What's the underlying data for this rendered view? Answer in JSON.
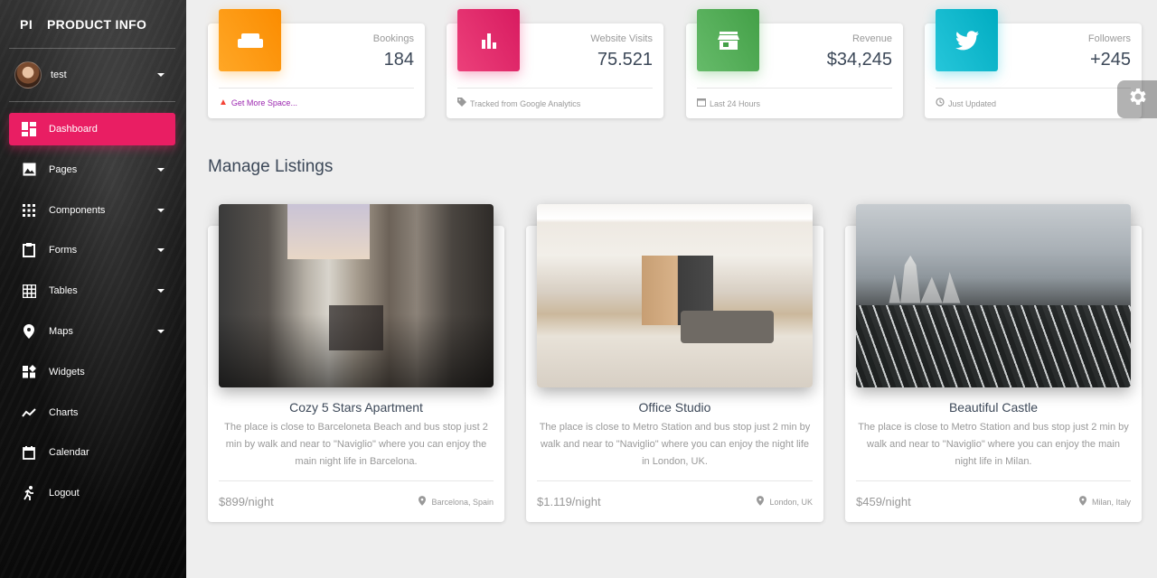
{
  "sidebar": {
    "logo_mini": "PI",
    "logo_full": "PRODUCT INFO",
    "user_name": "test",
    "items": [
      {
        "label": "Dashboard",
        "icon": "dashboard-icon",
        "active": true
      },
      {
        "label": "Pages",
        "icon": "image-icon",
        "has_caret": true
      },
      {
        "label": "Components",
        "icon": "apps-grid-icon",
        "has_caret": true
      },
      {
        "label": "Forms",
        "icon": "clipboard-icon",
        "has_caret": true
      },
      {
        "label": "Tables",
        "icon": "grid-icon",
        "has_caret": true
      },
      {
        "label": "Maps",
        "icon": "place-icon",
        "has_caret": true
      },
      {
        "label": "Widgets",
        "icon": "widgets-icon"
      },
      {
        "label": "Charts",
        "icon": "timeline-icon"
      },
      {
        "label": "Calendar",
        "icon": "calendar-icon"
      },
      {
        "label": "Logout",
        "icon": "run-icon"
      }
    ]
  },
  "stats": [
    {
      "title": "Bookings",
      "value": "184",
      "footer": "Get More Space...",
      "icon": "weekend-icon",
      "color": "#fb8c00",
      "footer_color": "#9c27b0",
      "footer_icon": "warning-icon",
      "footer_icon_color": "#f44336"
    },
    {
      "title": "Website Visits",
      "value": "75.521",
      "footer": "Tracked from Google Analytics",
      "icon": "equalizer-icon",
      "color": "#d81b60",
      "footer_icon": "tag-icon"
    },
    {
      "title": "Revenue",
      "value": "$34,245",
      "footer": "Last 24 Hours",
      "icon": "store-icon",
      "color": "#43a047",
      "footer_icon": "date-range-icon"
    },
    {
      "title": "Followers",
      "value": "+245",
      "footer": "Just Updated",
      "icon": "twitter-icon",
      "color": "#00acc1",
      "footer_icon": "update-icon"
    }
  ],
  "section_title": "Manage Listings",
  "listings": [
    {
      "title": "Cozy 5 Stars Apartment",
      "description": "The place is close to Barceloneta Beach and bus stop just 2 min by walk and near to \"Naviglio\" where you can enjoy the main night life in Barcelona.",
      "price": "$899/night",
      "location": "Barcelona, Spain",
      "image": "paris-street-photo"
    },
    {
      "title": "Office Studio",
      "description": "The place is close to Metro Station and bus stop just 2 min by walk and near to \"Naviglio\" where you can enjoy the night life in London, UK.",
      "price": "$1.119/night",
      "location": "London, UK",
      "image": "office-interior-photo"
    },
    {
      "title": "Beautiful Castle",
      "description": "The place is close to Metro Station and bus stop just 2 min by walk and near to \"Naviglio\" where you can enjoy the main night life in Milan.",
      "price": "$459/night",
      "location": "Milan, Italy",
      "image": "castle-photo"
    }
  ],
  "settings_icon": "gear-icon"
}
